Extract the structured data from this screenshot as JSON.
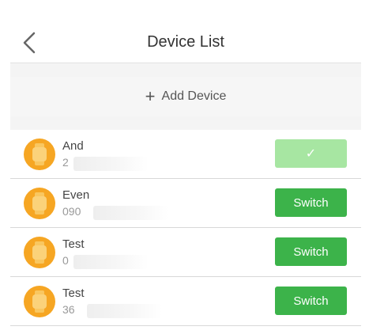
{
  "header": {
    "title": "Device List",
    "back_icon": "chevron-left-icon"
  },
  "add_device": {
    "icon": "plus-icon",
    "plus_glyph": "+",
    "label": "Add Device"
  },
  "devices": [
    {
      "name": "And",
      "id_prefix": "2",
      "button_label": "✓",
      "selected": true
    },
    {
      "name": "Even",
      "id_prefix": "090",
      "button_label": "Switch",
      "selected": false
    },
    {
      "name": "Test",
      "id_prefix": "0",
      "button_label": "Switch",
      "selected": false
    },
    {
      "name": "Test",
      "id_prefix": "36",
      "button_label": "Switch",
      "selected": false
    }
  ],
  "colors": {
    "accent_green": "#3cb34a",
    "selected_green": "#a7e6a2",
    "avatar_orange": "#f6a623"
  }
}
